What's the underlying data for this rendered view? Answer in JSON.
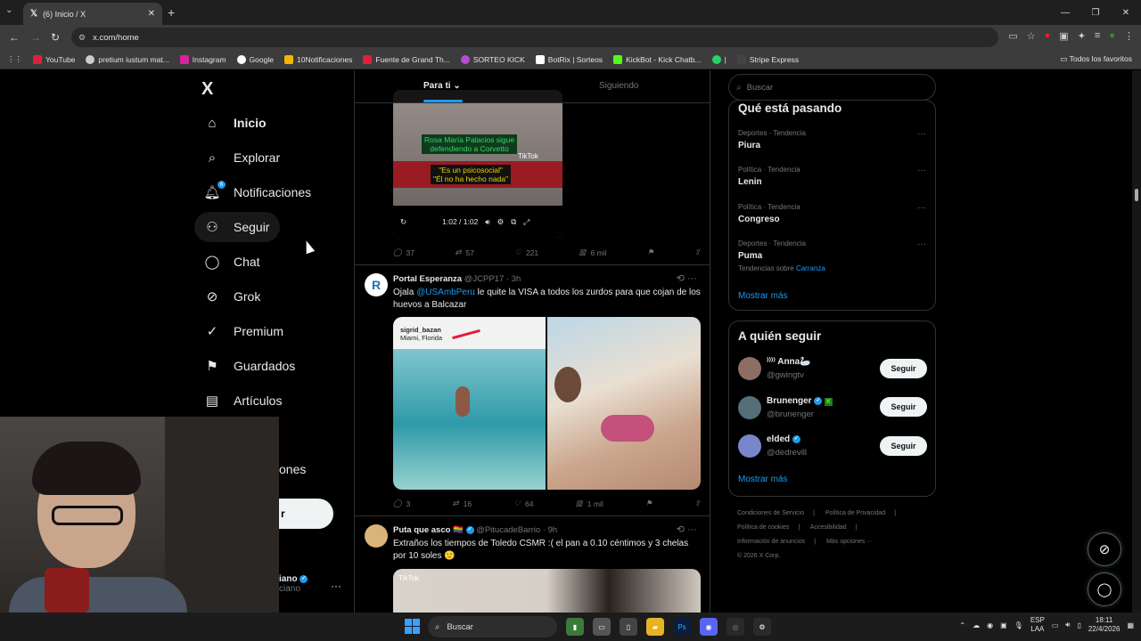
{
  "browser": {
    "tab_title": "(6) Inicio / X",
    "url": "x.com/home",
    "bookmarks": [
      "YouTube",
      "pretium iustum mat...",
      "Instagram",
      "Google",
      "10Notificaciones",
      "Fuente de Grand Th...",
      "SORTEO KICK",
      "BotRix | Sorteos",
      "KickBot - Kick Chatb...",
      "|",
      "Stripe Express"
    ],
    "bookmarks_right": "Todos los favoritos"
  },
  "nav": {
    "logo": "X",
    "items": [
      "Inicio",
      "Explorar",
      "Notificaciones",
      "Seguir",
      "Chat",
      "Grok",
      "Premium",
      "Guardados",
      "Artículos"
    ],
    "notif_badge": "6",
    "partial_item": "ones",
    "post_partial": "r",
    "account_partial": "iano",
    "account_handle_partial": "ciano",
    "account_more": "···"
  },
  "feed": {
    "tabs": [
      "Para ti",
      "Siguiendo"
    ],
    "tab_chevron": "⌄",
    "video": {
      "caption1": "Rosa María Palacios sigue\ndefendiendo a Corvetto",
      "caption2": "\"Es un psicosocial\"\n\"Él no ha hecho nada\"",
      "watermark": "TikTok",
      "time": "1:02 / 1:02"
    },
    "tweet1_actions": {
      "replies": "37",
      "reposts": "57",
      "likes": "221",
      "views": "6 mil"
    },
    "tweet2": {
      "name": "Portal Esperanza",
      "handle": "@JCPP17 · 3h",
      "text_pre": "Ojala ",
      "mention": "@USAmbPeru",
      "text_post": " le quite la VISA a todos los zurdos para que cojan de los huevos a Balcazar",
      "img_tag_name": "sigrid_bazan",
      "img_tag_loc": "Miami, Florida",
      "actions": {
        "replies": "3",
        "reposts": "16",
        "likes": "64",
        "views": "1 mil"
      }
    },
    "tweet3": {
      "name": "Puta que asco",
      "flag": "🏳️‍🌈",
      "handle": "@PitucadeBarrio · 9h",
      "text": "Extraños los tiempos de Toledo CSMR :(  el pan a 0.10 céntimos y 3 chelas por 10 soles 🙂",
      "thumb_label": "TikTok"
    }
  },
  "sidebar": {
    "search_placeholder": "Buscar",
    "trends_title": "Qué está pasando",
    "trends": [
      {
        "meta": "Deportes · Tendencia",
        "name": "Piura"
      },
      {
        "meta": "Política · Tendencia",
        "name": "Lenin"
      },
      {
        "meta": "Política · Tendencia",
        "name": "Congreso"
      },
      {
        "meta": "Deportes · Tendencia",
        "name": "Puma"
      }
    ],
    "trend_sub_pre": "Tendencias sobre ",
    "trend_sub_link": "Carranza",
    "show_more": "Mostrar más",
    "who_to_follow_title": "A quién seguir",
    "follow": [
      {
        "name": "⁾⁾⁾⁾ Anna🦢",
        "handle": "@gwingtv"
      },
      {
        "name": "Brunenger",
        "handle": "@brunenger"
      },
      {
        "name": "elded",
        "handle": "@dedrevill"
      }
    ],
    "follow_label": "Seguir",
    "footer": [
      "Condiciones de Servicio",
      "|",
      "Política de Privacidad",
      "|",
      "Política de cookies",
      "|",
      "Accesibilidad",
      "|",
      "Información de anuncios",
      "|",
      "Más opciones ···",
      "© 2026 X Corp."
    ]
  },
  "taskbar": {
    "search": "Buscar",
    "lang1": "ESP",
    "lang2": "LAA",
    "time": "18:11",
    "date": "22/4/2026"
  },
  "colors": {
    "accent": "#1d9bf0",
    "bg": "#000000",
    "border": "#2f3336",
    "muted": "#71767b"
  }
}
